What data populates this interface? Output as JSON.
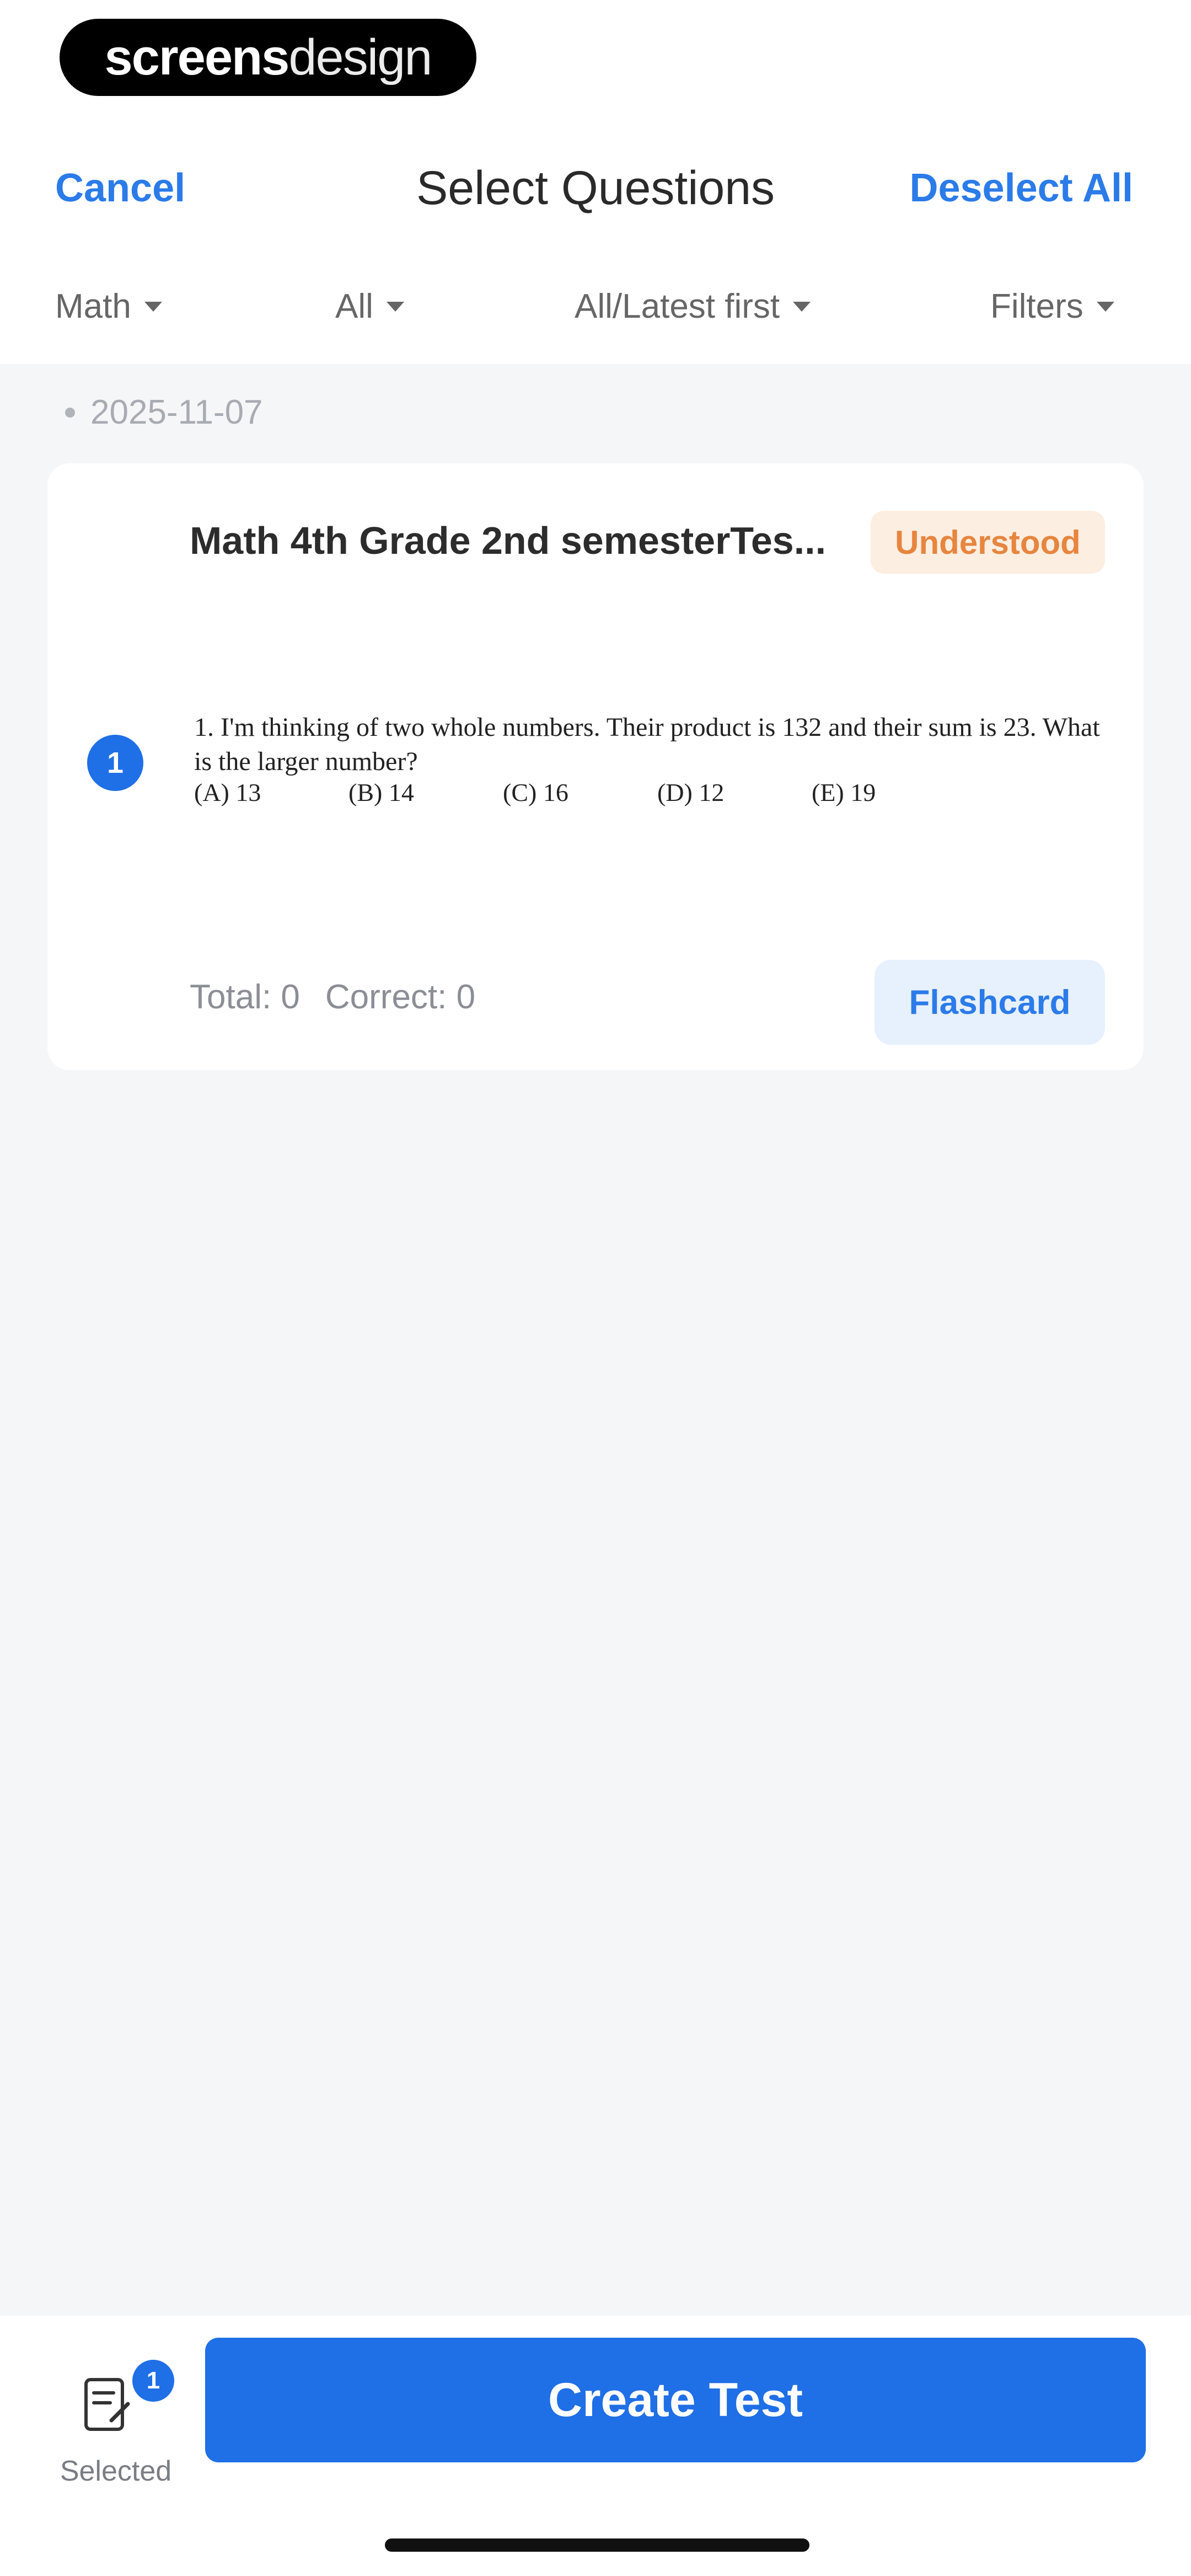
{
  "brand": {
    "logo_bold": "screens",
    "logo_light": "design"
  },
  "nav": {
    "cancel": "Cancel",
    "title": "Select Questions",
    "deselect_all": "Deselect All"
  },
  "filters": [
    {
      "label": "Math"
    },
    {
      "label": "All"
    },
    {
      "label": "All/Latest first"
    },
    {
      "label": "Filters"
    }
  ],
  "date_group": "2025-11-07",
  "card": {
    "title": "Math 4th Grade 2nd semesterTes...",
    "status": "Understood",
    "question_number": "1",
    "question_text": "1. I'm thinking of two whole numbers. Their product is 132 and their sum is 23. What is the larger number?",
    "options": [
      "(A) 13",
      "(B) 14",
      "(C) 16",
      "(D) 12",
      "(E) 19"
    ],
    "total": "Total: 0",
    "correct": "Correct: 0",
    "flashcard": "Flashcard"
  },
  "bottom": {
    "selected_count": "1",
    "selected_label": "Selected",
    "create_test": "Create Test"
  },
  "colors": {
    "accent": "#1f6fe6",
    "link": "#2b7be9",
    "badge_bg": "#fdeee2",
    "badge_text": "#e7853e",
    "background": "#f5f6f8"
  }
}
